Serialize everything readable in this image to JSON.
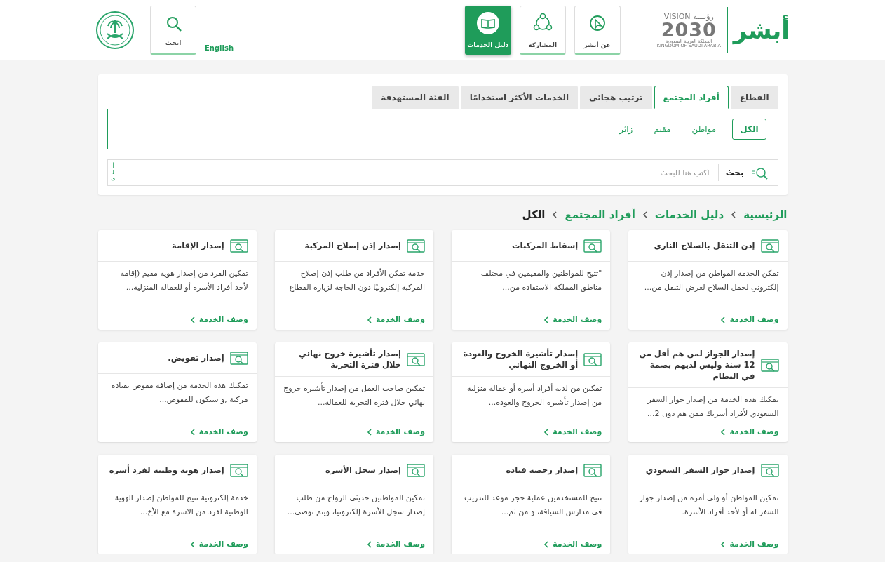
{
  "header": {
    "logo": {
      "wordmark": "أبشر",
      "vision_arabic": "رؤيـــة",
      "vision_english": "VISION",
      "vision_year": "2030",
      "kingdom_arabic": "المملكة العربية السعودية",
      "kingdom_english": "KINGDOM OF SAUDI ARABIA"
    },
    "nav_tiles": [
      {
        "kind": "about",
        "label": "عن أبشر",
        "selected": false
      },
      {
        "kind": "participation",
        "label": "المشاركة",
        "selected": false
      },
      {
        "kind": "guide",
        "label": "دليل الخدمات",
        "selected": true
      }
    ],
    "language_link": "English",
    "search_tile": {
      "label": "ابحث"
    }
  },
  "category_tabs": [
    {
      "label": "القطاع",
      "selected": false
    },
    {
      "label": "أفراد المجتمع",
      "selected": true
    },
    {
      "label": "ترتيب هجائي",
      "selected": false
    },
    {
      "label": "الخدمات الأكثر استخدامًا",
      "selected": false
    },
    {
      "label": "الفئة المستهدفة",
      "selected": false
    }
  ],
  "filters": [
    {
      "label": "الكل",
      "selected": true
    },
    {
      "label": "مواطن",
      "selected": false
    },
    {
      "label": "مقيم",
      "selected": false
    },
    {
      "label": "زائر",
      "selected": false
    }
  ],
  "search": {
    "label": "بحث",
    "placeholder": "اكتب هنا للبحث",
    "sort_indicator": "أ↓ى"
  },
  "breadcrumb": [
    {
      "label": "الرئيسية",
      "current": false
    },
    {
      "label": "دليل الخدمات",
      "current": false
    },
    {
      "label": "أفراد المجتمع",
      "current": false
    },
    {
      "label": "الكل",
      "current": true
    }
  ],
  "cards": [
    {
      "title": "إذن التنقل بالسلاح الناري",
      "description": "تمكن الخدمة المواطن من إصدار إذن إلكتروني لحمل السلاح لغرض التنقل من...",
      "link": "وصف الخدمة"
    },
    {
      "title": "إسقاط المركبات",
      "description": "\"تتيح للمواطنين والمقيمين في مختلف مناطق المملكة الاستفادة من...",
      "link": "وصف الخدمة"
    },
    {
      "title": "إصدار إذن إصلاح المركبة",
      "description": "خدمة تمكن الأفراد من طلب إذن إصلاح المركبة إلكترونيًا دون الحاجة لزيارة القطاع",
      "link": "وصف الخدمة"
    },
    {
      "title": "إصدار الإقامة",
      "description": "تمكين الفرد من إصدار هوية مقيم (إقامة لأحد أفراد الأسرة أو للعمالة المنزلية...",
      "link": "وصف الخدمة"
    },
    {
      "title": "إصدار الجواز لمن هم أقل من 12 سنة وليس لديهم بصمة في النظام",
      "description": "تمكنك هذه الخدمة من إصدار جواز السفر السعودي لأفراد أسرتك ممن هم دون 2...",
      "link": "وصف الخدمة"
    },
    {
      "title": "إصدار تأشيرة الخروج والعودة أو الخروج النهائي",
      "description": "تمكين من لديه أفراد أسرة أو عمالة منزلية من إصدار تأشيرة الخروج والعودة...",
      "link": "وصف الخدمة"
    },
    {
      "title": "إصدار تأشيرة خروج نهائي خلال فترة التجربة",
      "description": "تمكين صاحب العمل من إصدار تأشيرة خروج نهائي خلال فترة التجربة للعمالة...",
      "link": "وصف الخدمة"
    },
    {
      "title": "إصدار تفويض.",
      "description": "تمكنك هذه الخدمة من إضافة مفوض بقيادة مركبة ,و ستكون للمفوض...",
      "link": "وصف الخدمة"
    },
    {
      "title": "إصدار جواز السفر السعودي",
      "description": "تمكين المواطن أو ولي أمره من إصدار جواز السفر له أو لأحد أفراد الأسرة.",
      "link": "وصف الخدمة"
    },
    {
      "title": "إصدار رخصة قيادة",
      "description": "تتيح للمستخدمين عملية حجز موعد للتدريب في مدارس السياقة، و من ثم...",
      "link": "وصف الخدمة"
    },
    {
      "title": "إصدار سجل الأسرة",
      "description": "تمكين المواطنين حديثي الزواج من طلب إصدار سجل الأسرة إلكترونيا، ويتم توصي...",
      "link": "وصف الخدمة"
    },
    {
      "title": "إصدار هوية وطنية لفرد أسرة",
      "description": "خدمة إلكترونية تتيح للمواطن إصدار الهوية الوطنية لفرد من الاسرة مع الأخ...",
      "link": "وصف الخدمة"
    }
  ]
}
